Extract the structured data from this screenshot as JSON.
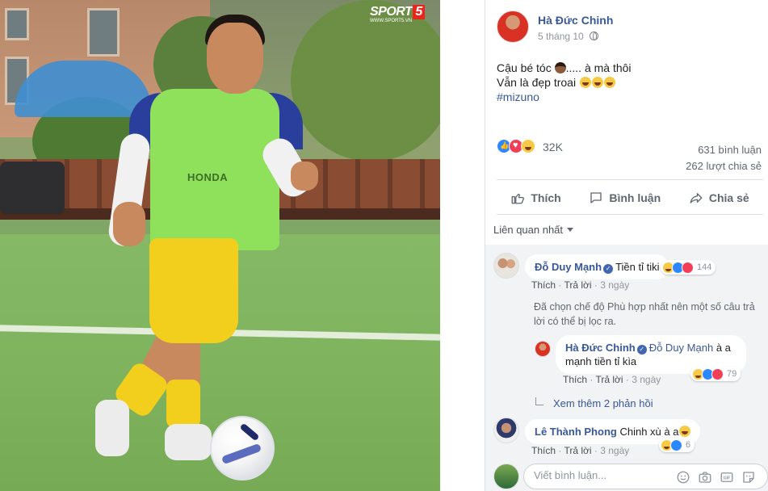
{
  "photo": {
    "watermark": {
      "brand": "SPORT",
      "number": "5",
      "url": "WWW.SPORT5.VN"
    },
    "bib_text": "HONDA"
  },
  "post": {
    "author": "Hà Đức Chinh",
    "date": "5 tháng 10",
    "line1_text": "Cậu bé tóc",
    "line1_tail": "..... à mà thôi",
    "line2_text": "Vẫn là đẹp troai",
    "hashtag": "#mizuno",
    "reaction_count": "32K",
    "comment_count": "631 bình luận",
    "share_count": "262 lượt chia sẻ"
  },
  "actions": {
    "like": "Thích",
    "comment": "Bình luận",
    "share": "Chia sẻ"
  },
  "filter": {
    "label": "Liên quan nhất"
  },
  "comments": [
    {
      "name": "Đỗ Duy Mạnh",
      "text": "Tiền tỉ tiki",
      "reactions": "144",
      "like": "Thích",
      "reply": "Trả lời",
      "time": "3 ngày"
    },
    {
      "notice": "Đã chọn chế độ Phù hợp nhất nên một số câu trả lời có thể bị lọc ra."
    },
    {
      "name": "Hà Đức Chinh",
      "mention": "Đỗ Duy Mạnh",
      "text": "à a mạnh tiền tỉ kìa",
      "reactions": "79",
      "like": "Thích",
      "reply": "Trả lời",
      "time": "3 ngày"
    },
    {
      "more_replies": "Xem thêm 2 phản hồi"
    },
    {
      "name": "Lê Thành Phong",
      "text": "Chinh xù à a",
      "reactions": "6",
      "like": "Thích",
      "reply": "Trả lời",
      "time": "3 ngày"
    }
  ],
  "composer": {
    "placeholder": "Viết bình luận..."
  },
  "colors": {
    "link": "#385898",
    "verified": "#4267b2",
    "like": "#2d88ff",
    "love": "#f33e58",
    "haha": "#f7c944"
  }
}
